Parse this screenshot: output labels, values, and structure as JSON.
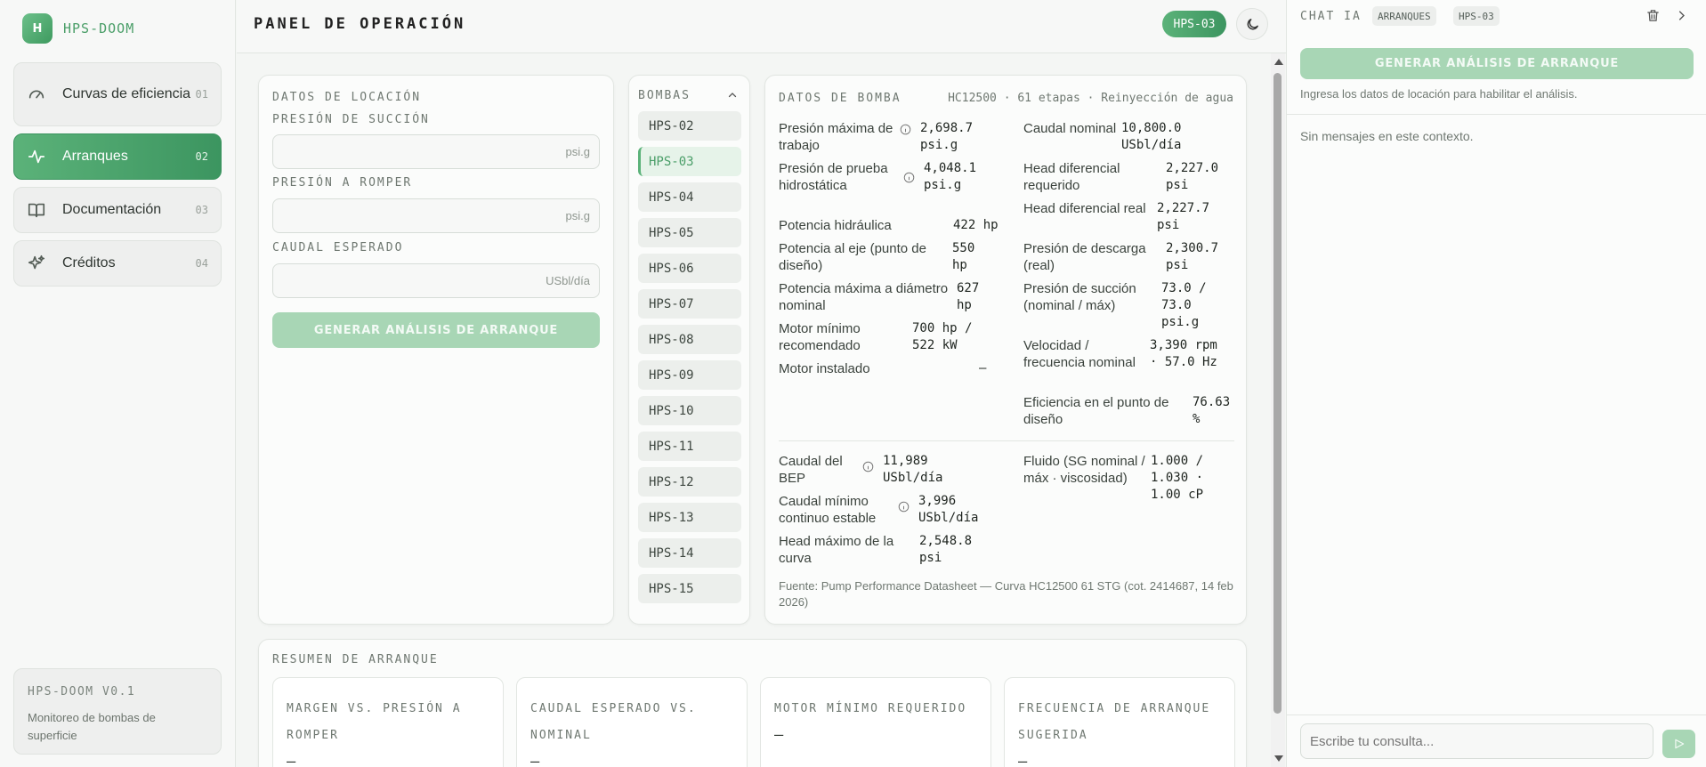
{
  "app": {
    "logo_letter": "H",
    "name": "HPS-DOOM",
    "version_title": "HPS-DOOM V0.1",
    "version_desc": "Monitoreo de bombas de superficie"
  },
  "nav": [
    {
      "label": "Curvas de eficiencia",
      "num": "01",
      "icon": "gauge-icon"
    },
    {
      "label": "Arranques",
      "num": "02",
      "icon": "activity-icon"
    },
    {
      "label": "Documentación",
      "num": "03",
      "icon": "book-icon"
    },
    {
      "label": "Créditos",
      "num": "04",
      "icon": "sparkles-icon"
    }
  ],
  "header": {
    "title": "PANEL DE OPERACIÓN",
    "pump_badge": "HPS-03",
    "theme_icon": "moon-icon"
  },
  "location": {
    "title": "DATOS DE LOCACIÓN",
    "fields": [
      {
        "label": "PRESIÓN DE SUCCIÓN",
        "value": "",
        "unit": "psi.g"
      },
      {
        "label": "PRESIÓN A ROMPER",
        "value": "",
        "unit": "psi.g"
      },
      {
        "label": "CAUDAL ESPERADO",
        "value": "",
        "unit": "USbl/día"
      }
    ],
    "button": "GENERAR ANÁLISIS DE ARRANQUE"
  },
  "pumps": {
    "title": "BOMBAS",
    "selected": "HPS-03",
    "items": [
      "HPS-02",
      "HPS-03",
      "HPS-04",
      "HPS-05",
      "HPS-06",
      "HPS-07",
      "HPS-08",
      "HPS-09",
      "HPS-10",
      "HPS-11",
      "HPS-12",
      "HPS-13",
      "HPS-14",
      "HPS-15"
    ]
  },
  "pump_data": {
    "title": "DATOS DE BOMBA",
    "model_line": "HC12500 · 61 etapas · Reinyección de agua",
    "left": [
      {
        "label": "Presión máxima de trabajo",
        "value": "2,698.7 psi.g"
      },
      {
        "label": "Presión de prueba hidrostática",
        "value": "4,048.1 psi.g"
      },
      {
        "label": "Potencia hidráulica",
        "value": "422 hp"
      },
      {
        "label": "Potencia al eje (punto de diseño)",
        "value": "550 hp"
      },
      {
        "label": "Potencia máxima a diámetro nominal",
        "value": "627 hp"
      },
      {
        "label": "Motor mínimo recomendado",
        "value": "700 hp / 522 kW"
      },
      {
        "label": "Motor instalado",
        "value": "—"
      }
    ],
    "right": [
      {
        "label": "Caudal nominal",
        "value": "10,800.0 USbl/día"
      },
      {
        "label": "Head diferencial requerido",
        "value": "2,227.0 psi"
      },
      {
        "label": "Head diferencial real",
        "value": "2,227.7 psi"
      },
      {
        "label": "Presión de descarga (real)",
        "value": "2,300.7 psi"
      },
      {
        "label": "Presión de succión (nominal / máx)",
        "value": "73.0 / 73.0 psi.g"
      },
      {
        "label": "Velocidad / frecuencia nominal",
        "value": "3,390 rpm · 57.0 Hz"
      },
      {
        "label": "Eficiencia en el punto de diseño",
        "value": "76.63 %"
      }
    ],
    "bottom_left": [
      {
        "label": "Caudal del BEP",
        "value": "11,989 USbl/día"
      },
      {
        "label": "Caudal mínimo continuo estable",
        "value": "3,996 USbl/día"
      },
      {
        "label": "Head máximo de la curva",
        "value": "2,548.8 psi"
      }
    ],
    "bottom_right": [
      {
        "label": "Fluido (SG nominal / máx · viscosidad)",
        "value": "1.000 / 1.030 · 1.00 cP"
      }
    ],
    "source": "Fuente: Pump Performance Datasheet — Curva HC12500 61 STG (cot. 2414687, 14 feb 2026)"
  },
  "summary": {
    "title": "RESUMEN DE ARRANQUE",
    "boxes": [
      {
        "title": "MARGEN VS. PRESIÓN A ROMPER",
        "value": "—"
      },
      {
        "title": "CAUDAL ESPERADO VS. NOMINAL",
        "value": "—"
      },
      {
        "title": "MOTOR MÍNIMO REQUERIDO",
        "value": "—"
      },
      {
        "title": "FRECUENCIA DE ARRANQUE SUGERIDA",
        "value": "—"
      }
    ]
  },
  "chat": {
    "title": "CHAT IA",
    "chips": [
      "ARRANQUES",
      "HPS-03"
    ],
    "button": "GENERAR ANÁLISIS DE ARRANQUE",
    "hint": "Ingresa los datos de locación para habilitar el análisis.",
    "empty": "Sin mensajes en este contexto.",
    "input_placeholder": "Escribe tu consulta..."
  },
  "colors": {
    "accent": "#4a9e68",
    "accent_dark": "#3c9560",
    "accent_disabled": "#a8d6b5"
  }
}
